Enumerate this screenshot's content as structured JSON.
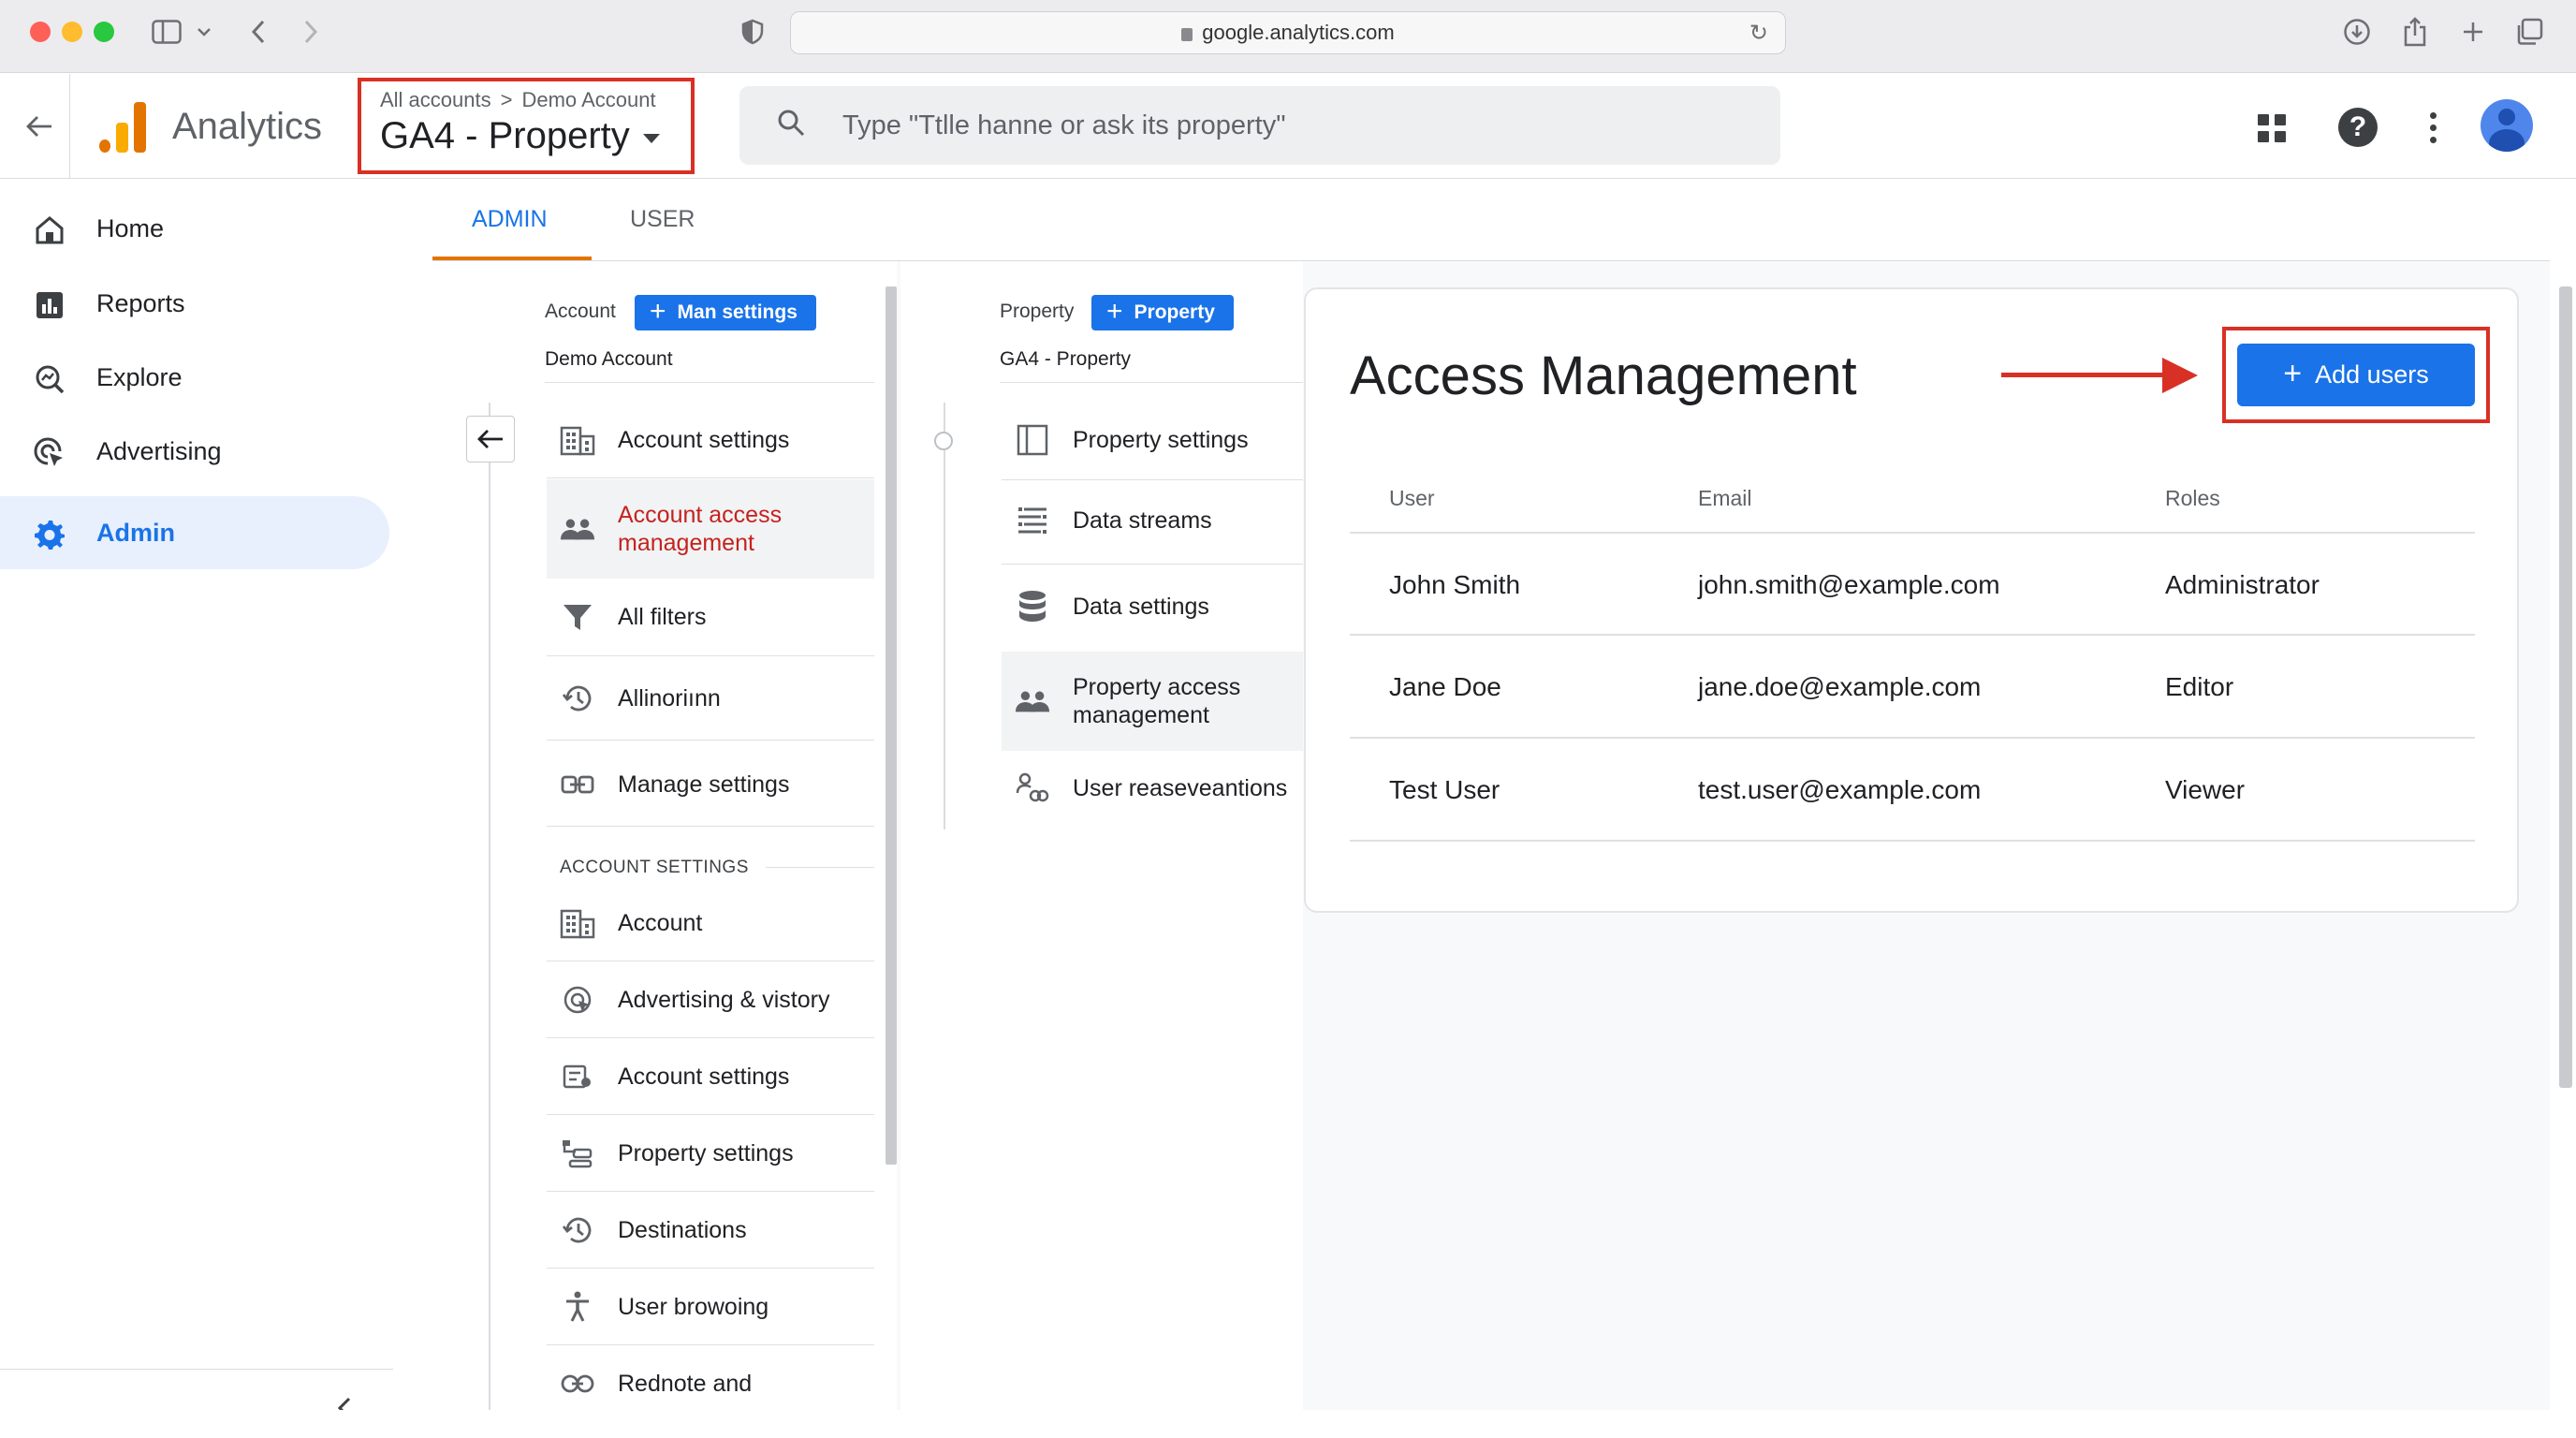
{
  "browser": {
    "url": "google.analytics.com"
  },
  "header": {
    "app_name": "Analytics",
    "breadcrumb_root": "All accounts",
    "breadcrumb_separator": ">",
    "breadcrumb_account": "Demo Account",
    "property_name": "GA4 - Property",
    "search_placeholder": "Type \"Ttlle hanne or ask its property\"",
    "highlight_color": "#d93025"
  },
  "leftnav": {
    "items": [
      {
        "label": "Home",
        "icon": "home-icon"
      },
      {
        "label": "Reports",
        "icon": "bar-chart-icon"
      },
      {
        "label": "Explore",
        "icon": "explore-icon"
      },
      {
        "label": "Advertising",
        "icon": "advertising-icon"
      },
      {
        "label": "Admin",
        "icon": "gear-icon",
        "active": true
      }
    ]
  },
  "tabs": [
    {
      "label": "ADMIN",
      "active": true
    },
    {
      "label": "USER",
      "active": false
    }
  ],
  "account_column": {
    "heading": "Account",
    "button_label": "Man settings",
    "account_name": "Demo Account",
    "items": [
      {
        "label": "Account settings",
        "icon": "building-icon"
      },
      {
        "label": "Account access management",
        "icon": "people-icon",
        "selected": true
      },
      {
        "label": "All filters",
        "icon": "filter-icon"
      },
      {
        "label": "Allinoriınn",
        "icon": "history-icon"
      },
      {
        "label": "Manage settings",
        "icon": "link-settings-icon"
      }
    ],
    "section_heading": "ACCOUNT SETTINGS",
    "section_items": [
      {
        "label": "Account",
        "icon": "building-icon"
      },
      {
        "label": "Advertising & vistory",
        "icon": "advertising-icon"
      },
      {
        "label": "Account settings",
        "icon": "account-settings-icon"
      },
      {
        "label": "Property settings",
        "icon": "property-settings-icon"
      },
      {
        "label": "Destinations",
        "icon": "history-icon"
      },
      {
        "label": "User browoing",
        "icon": "accessibility-icon"
      },
      {
        "label": "Rednote and",
        "icon": "link-icon"
      }
    ]
  },
  "property_column": {
    "heading": "Property",
    "button_label": "Property",
    "property_name": "GA4 - Property",
    "items": [
      {
        "label": "Property settings",
        "icon": "property-icon"
      },
      {
        "label": "Data streams",
        "icon": "data-streams-icon"
      },
      {
        "label": "Data settings",
        "icon": "database-icon"
      },
      {
        "label": "Property access management",
        "icon": "people-icon",
        "selected": true
      },
      {
        "label": "User reaseveantions",
        "icon": "user-link-icon"
      }
    ]
  },
  "access_management": {
    "title": "Access Management",
    "add_button_label": "Add users",
    "columns": [
      "User",
      "Email",
      "Roles"
    ],
    "rows": [
      {
        "user": "John Smith",
        "email": "john.smith@example.com",
        "role": "Administrator"
      },
      {
        "user": "Jane Doe",
        "email": "jane.doe@example.com",
        "role": "Editor"
      },
      {
        "user": "Test User",
        "email": "test.user@example.com",
        "role": "Viewer"
      }
    ]
  },
  "colors": {
    "accent": "#1a73e8",
    "tab_underline": "#e37400",
    "annotation_red": "#d93025"
  }
}
